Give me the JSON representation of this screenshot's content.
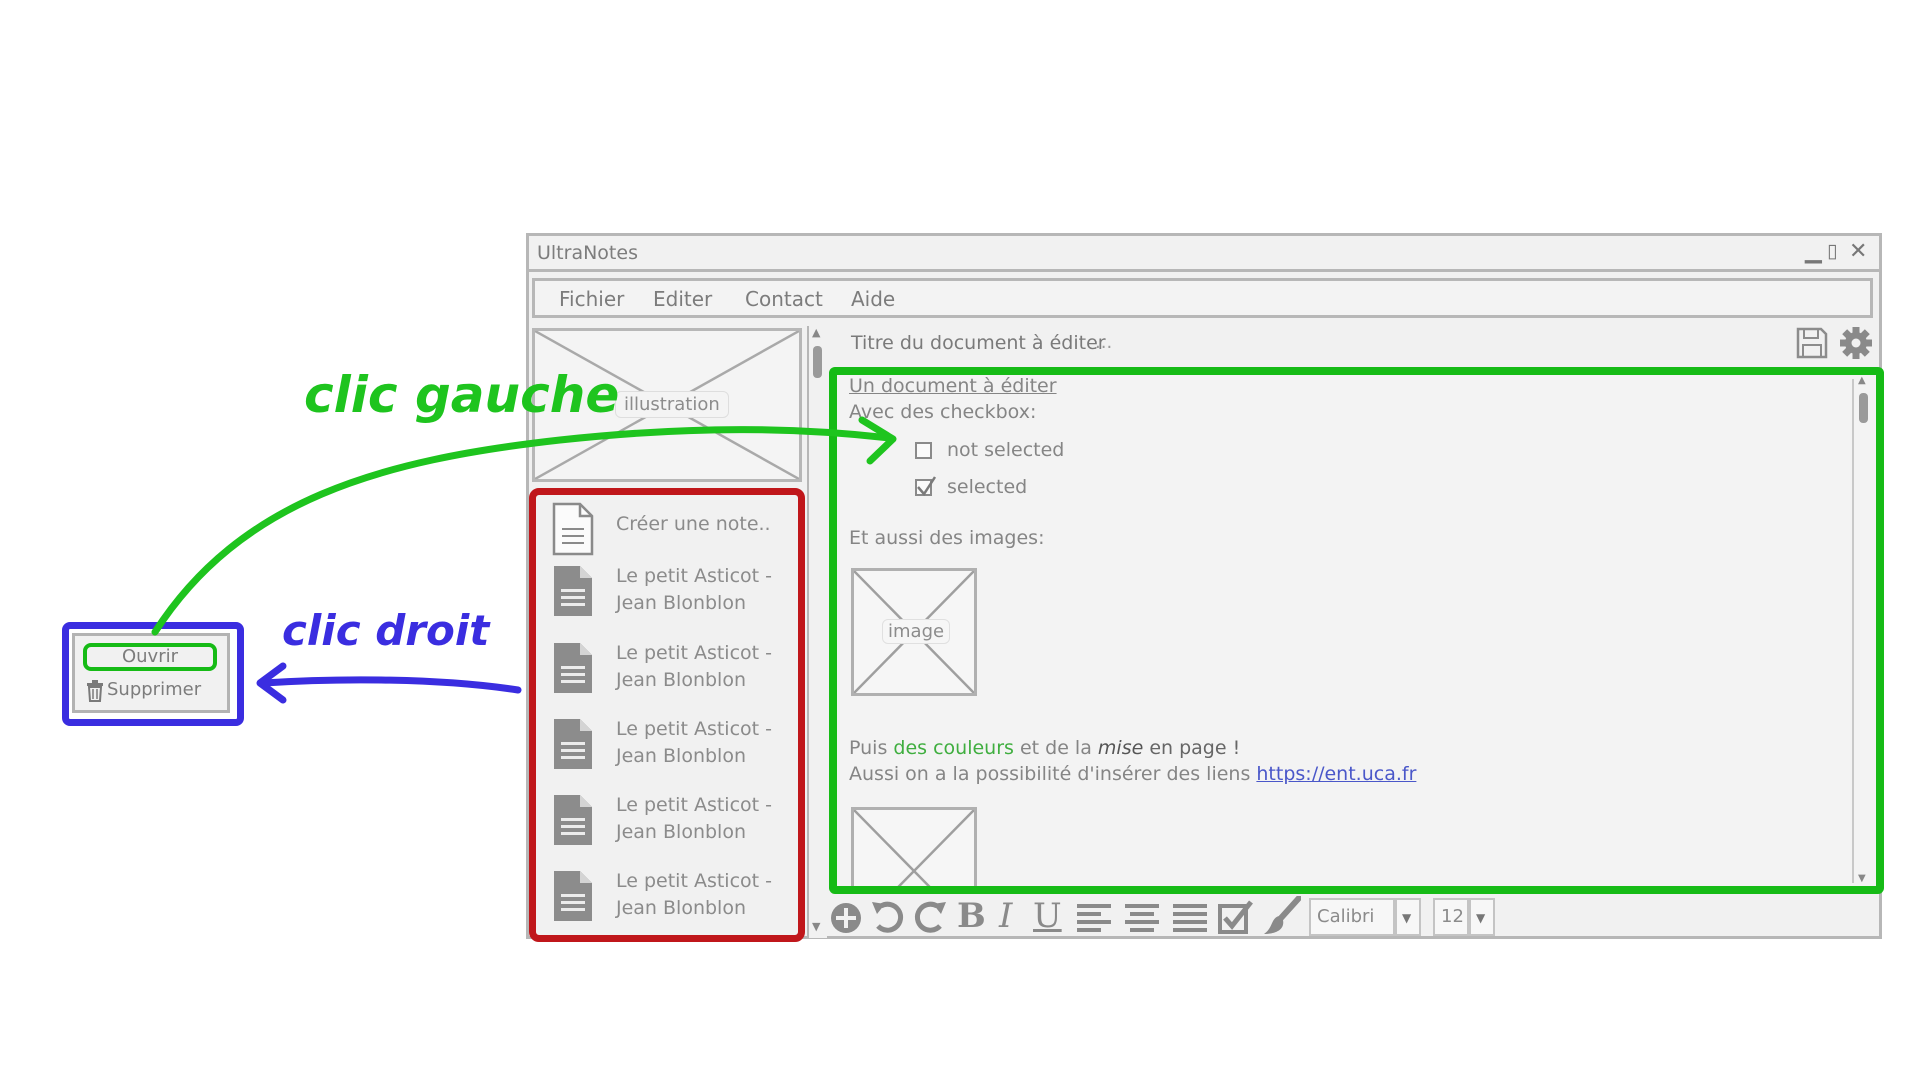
{
  "app": {
    "title": "UltraNotes",
    "window_controls": [
      "minimize",
      "maximize",
      "close"
    ]
  },
  "menu": [
    "Fichier",
    "Editer",
    "Contact",
    "Aide"
  ],
  "sidebar": {
    "illustration_label": "illustration",
    "create_note": "Créer une note..",
    "notes": [
      {
        "line1": "Le petit Asticot -",
        "line2": "Jean Blonblon"
      },
      {
        "line1": "Le petit Asticot -",
        "line2": "Jean Blonblon"
      },
      {
        "line1": "Le petit Asticot -",
        "line2": "Jean Blonblon"
      },
      {
        "line1": "Le petit Asticot -",
        "line2": "Jean Blonblon"
      },
      {
        "line1": "Le petit Asticot -",
        "line2": "Jean Blonblon"
      }
    ]
  },
  "document": {
    "title_field": "Titre du document à éditer",
    "title_ellipsis": "...",
    "heading": "Un document à éditer",
    "checkbox_intro": "Avec des checkbox:",
    "checkbox_unchecked": "not selected",
    "checkbox_checked": "selected",
    "images_intro": "Et aussi des images:",
    "image_label": "image",
    "colors_line": {
      "prefix": "Puis ",
      "colored": "des couleurs",
      "middle": " et de la ",
      "italic": "mise",
      "suffix": " en page !"
    },
    "links_line": {
      "text": "Aussi on a la possibilité d'insérer des liens ",
      "link": "https://ent.uca.fr"
    }
  },
  "toolbar": {
    "font": "Calibri",
    "size": "12",
    "icons": [
      "add-icon",
      "undo-icon",
      "redo-icon",
      "bold-icon",
      "italic-icon",
      "underline-icon",
      "align-left-icon",
      "align-center-icon",
      "align-justify-icon",
      "checkbox-icon",
      "brush-icon"
    ]
  },
  "context_menu": {
    "open": "Ouvrir",
    "delete": "Supprimer"
  },
  "annotations": {
    "left_click": "clic gauche",
    "right_click": "clic droit"
  },
  "colors": {
    "green_highlight": "#16bb16",
    "red_highlight": "#c0171b",
    "blue_highlight": "#3a2de0",
    "link": "#4a57c9",
    "colored_text": "#3fae3f"
  }
}
